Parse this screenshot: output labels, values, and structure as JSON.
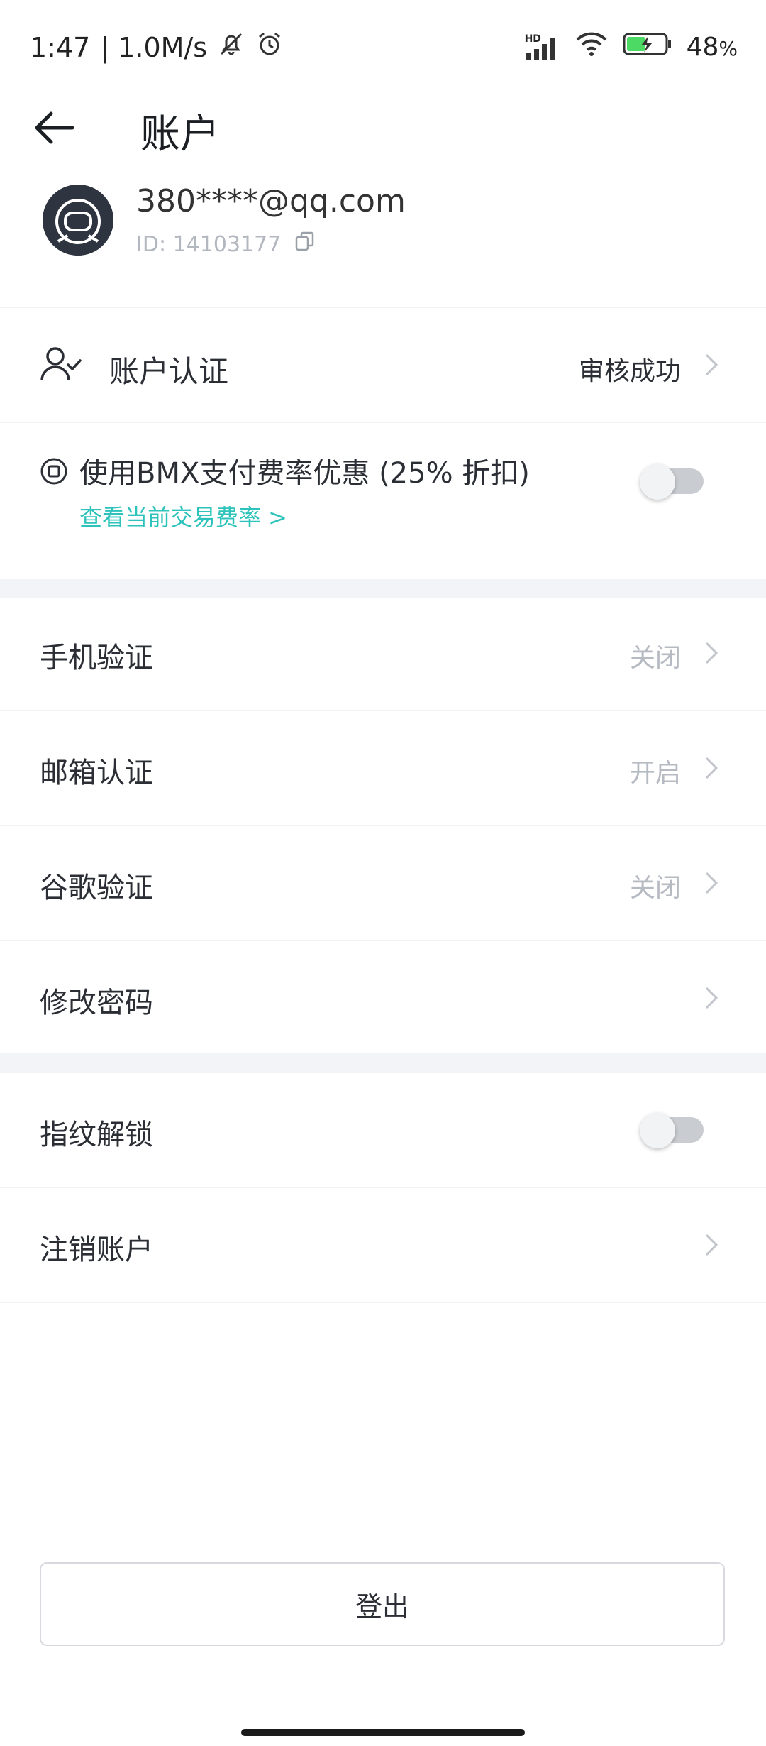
{
  "status_bar": {
    "time": "1:47",
    "net_speed": "| 1.0M/s",
    "battery": "48",
    "battery_unit": "%",
    "signal_label": "HD"
  },
  "header": {
    "title": "账户"
  },
  "profile": {
    "email": "380****@qq.com",
    "uid": "ID: 14103177"
  },
  "verification": {
    "label": "账户认证",
    "status": "审核成功"
  },
  "bmx": {
    "label": "使用BMX支付费率优惠 (25% 折扣)",
    "link": "查看当前交易费率 >",
    "enabled": false
  },
  "security": [
    {
      "label": "手机验证",
      "value": "关闭"
    },
    {
      "label": "邮箱认证",
      "value": "开启"
    },
    {
      "label": "谷歌验证",
      "value": "关闭"
    },
    {
      "label": "修改密码",
      "value": ""
    }
  ],
  "fingerprint": {
    "label": "指纹解锁",
    "enabled": false
  },
  "cancel_account": {
    "label": "注销账户"
  },
  "logout_label": "登出",
  "colors": {
    "accent": "#2dc3bb",
    "section_bg": "#f3f4f8"
  }
}
